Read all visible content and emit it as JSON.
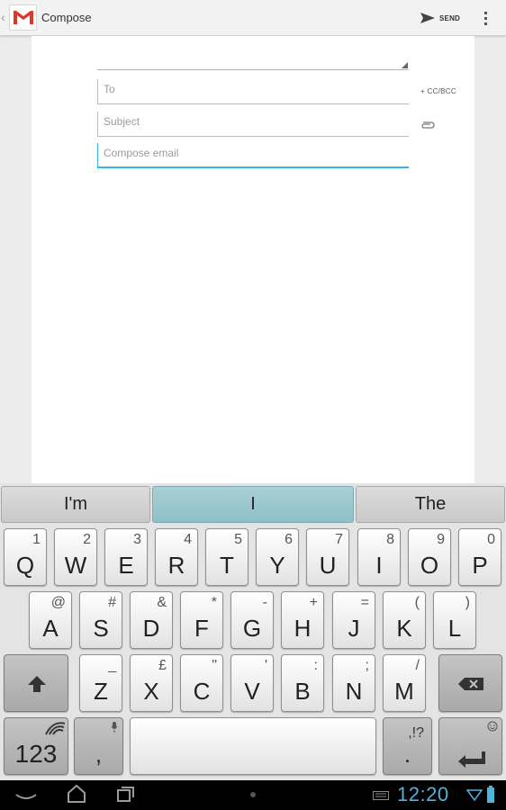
{
  "action_bar": {
    "title": "Compose",
    "send_label": "SEND"
  },
  "compose": {
    "to_placeholder": "To",
    "subject_placeholder": "Subject",
    "body_placeholder": "Compose email",
    "ccbcc_label": "+ CC/BCC"
  },
  "keyboard": {
    "suggestions": [
      "I'm",
      "I",
      "The"
    ],
    "row0": [
      {
        "p": "Q",
        "s": "1"
      },
      {
        "p": "W",
        "s": "2"
      },
      {
        "p": "E",
        "s": "3"
      },
      {
        "p": "R",
        "s": "4"
      },
      {
        "p": "T",
        "s": "5"
      },
      {
        "p": "Y",
        "s": "6"
      },
      {
        "p": "U",
        "s": "7"
      },
      {
        "p": "I",
        "s": "8"
      },
      {
        "p": "O",
        "s": "9"
      },
      {
        "p": "P",
        "s": "0"
      }
    ],
    "row1": [
      {
        "p": "A",
        "s": "@"
      },
      {
        "p": "S",
        "s": "#"
      },
      {
        "p": "D",
        "s": "&"
      },
      {
        "p": "F",
        "s": "*"
      },
      {
        "p": "G",
        "s": "-"
      },
      {
        "p": "H",
        "s": "+"
      },
      {
        "p": "J",
        "s": "="
      },
      {
        "p": "K",
        "s": "("
      },
      {
        "p": "L",
        "s": ")"
      }
    ],
    "row2": [
      {
        "p": "Z",
        "s": "_"
      },
      {
        "p": "X",
        "s": "£"
      },
      {
        "p": "C",
        "s": "\""
      },
      {
        "p": "V",
        "s": "'"
      },
      {
        "p": "B",
        "s": ":"
      },
      {
        "p": "N",
        "s": ";"
      },
      {
        "p": "M",
        "s": "/"
      }
    ],
    "symbols_label": "123",
    "comma_label": ",",
    "period_label": ".",
    "period_secondary": ",!?"
  },
  "status": {
    "time": "12:20"
  }
}
